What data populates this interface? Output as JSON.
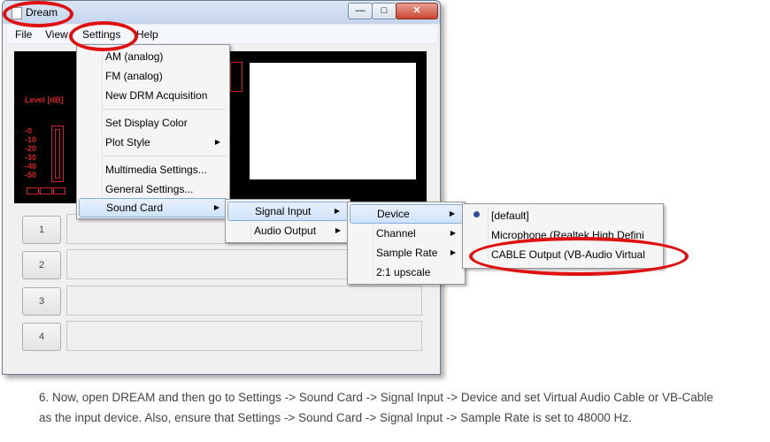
{
  "window": {
    "title": "Dream",
    "buttons": {
      "minimize": "—",
      "maximize": "□",
      "close": "✕"
    }
  },
  "menubar": [
    "File",
    "View",
    "Settings",
    "Help"
  ],
  "display": {
    "level_label": "Level [dB]",
    "scale": [
      "-0",
      "-10",
      "-20",
      "-30",
      "-40",
      "-50"
    ]
  },
  "rows": [
    "1",
    "2",
    "3",
    "4"
  ],
  "settings_menu": {
    "items": [
      "AM (analog)",
      "FM (analog)",
      "New DRM Acquisition",
      "Set Display Color",
      "Plot Style",
      "Multimedia Settings...",
      "General Settings...",
      "Sound Card"
    ]
  },
  "sound_card_menu": {
    "items": [
      "Signal Input",
      "Audio Output"
    ]
  },
  "signal_input_menu": {
    "items": [
      "Device",
      "Channel",
      "Sample Rate",
      "2:1 upscale"
    ]
  },
  "device_menu": {
    "items": [
      "[default]",
      "Microphone (Realtek High Defini",
      "CABLE Output (VB-Audio Virtual"
    ]
  },
  "annotation_color": "#e01010",
  "caption": {
    "line1": "6. Now, open DREAM and then go to Settings -> Sound Card -> Signal Input -> Device and set Virtual Audio Cable or VB-Cable",
    "line2": "as the input device. Also, ensure that Settings -> Sound Card -> Signal Input -> Sample Rate is set to 48000 Hz."
  }
}
